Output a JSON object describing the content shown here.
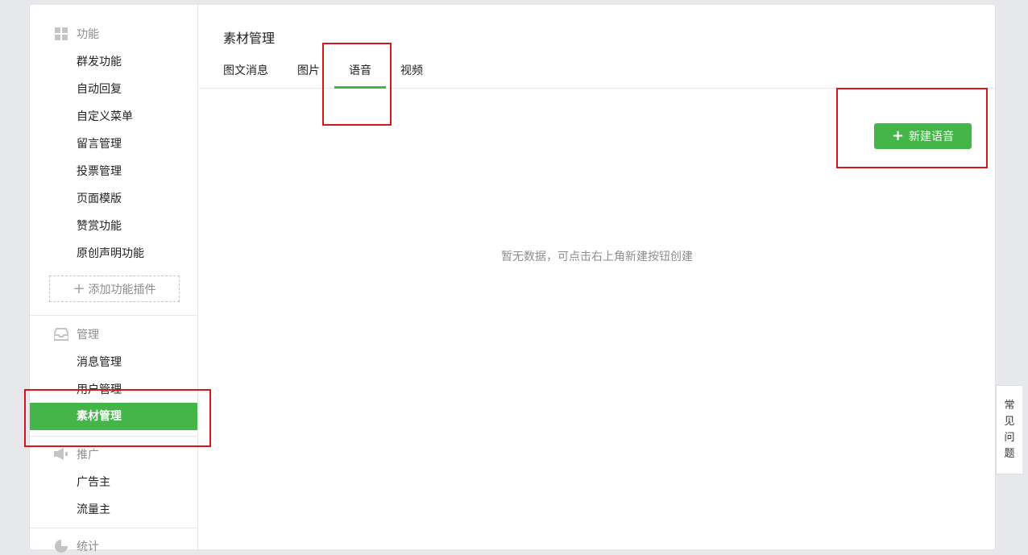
{
  "sidebar": {
    "sections": [
      {
        "title": "功能",
        "icon": "grid-icon",
        "items": [
          "群发功能",
          "自动回复",
          "自定义菜单",
          "留言管理",
          "投票管理",
          "页面模版",
          "赞赏功能",
          "原创声明功能"
        ]
      },
      {
        "title": "管理",
        "icon": "inbox-icon",
        "items": [
          "消息管理",
          "用户管理",
          "素材管理"
        ]
      },
      {
        "title": "推广",
        "icon": "megaphone-icon",
        "items": [
          "广告主",
          "流量主"
        ]
      },
      {
        "title": "统计",
        "icon": "pie-chart-icon",
        "items": []
      }
    ],
    "add_plugin_label": "添加功能插件",
    "active_item": "素材管理"
  },
  "main": {
    "title": "素材管理",
    "tabs": [
      {
        "label": "图文消息",
        "active": false
      },
      {
        "label": "图片",
        "active": false
      },
      {
        "label": "语音",
        "active": true
      },
      {
        "label": "视频",
        "active": false
      }
    ],
    "new_button_label": "新建语音",
    "empty_text": "暂无数据，可点击右上角新建按钮创建"
  },
  "help": {
    "chars": [
      "常",
      "见",
      "问",
      "题"
    ]
  },
  "colors": {
    "accent": "#44b549",
    "highlight": "#d9141c"
  }
}
